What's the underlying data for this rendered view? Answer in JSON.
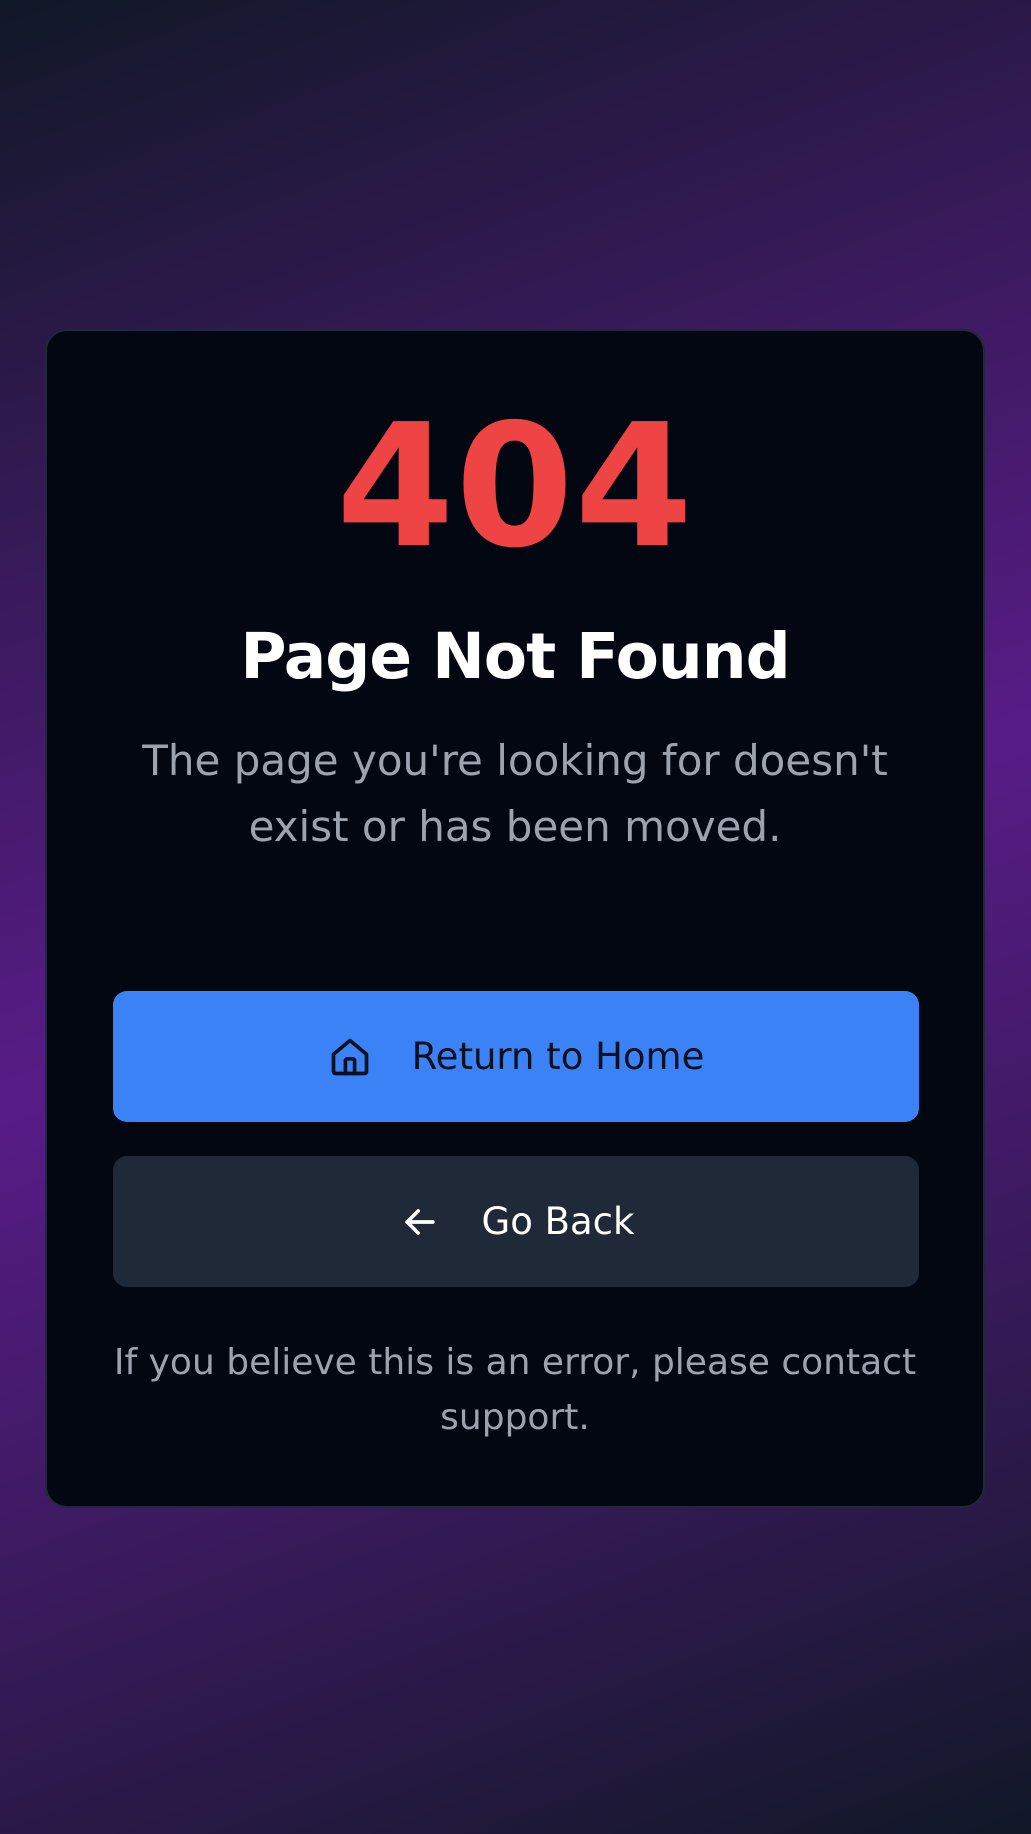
{
  "error": {
    "code": "404",
    "title": "Page Not Found",
    "description": "The page you're looking for doesn't exist or has been moved."
  },
  "actions": {
    "home_label": "Return to Home",
    "back_label": "Go Back"
  },
  "footer": {
    "note": "If you believe this is an error, please contact support."
  },
  "icons": {
    "home": "home-icon",
    "back": "arrow-left-icon"
  },
  "colors": {
    "accent": "#3b82f6",
    "error": "#ef4444",
    "card_bg": "#030712",
    "secondary_button": "#1f2937",
    "muted_text": "#9ca3af"
  }
}
